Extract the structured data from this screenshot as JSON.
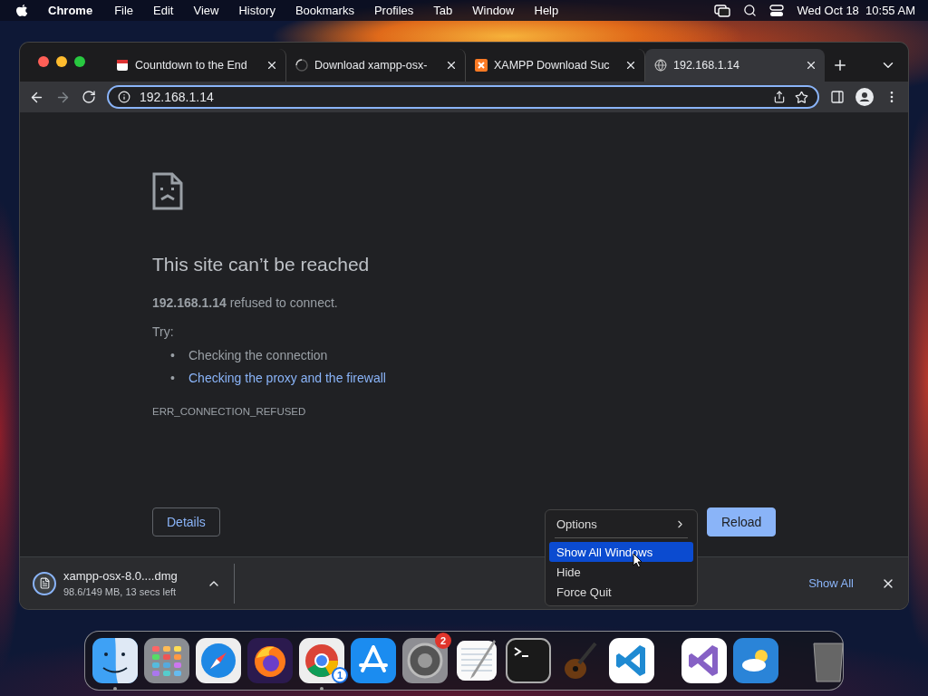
{
  "menu_bar": {
    "app": "Chrome",
    "items": [
      "File",
      "Edit",
      "View",
      "History",
      "Bookmarks",
      "Profiles",
      "Tab",
      "Window",
      "Help"
    ],
    "clock": "Wed Oct 18  10:55 AM"
  },
  "tabs": [
    {
      "title": "Countdown to the End",
      "selected": false
    },
    {
      "title": "Download xampp-osx-",
      "selected": false
    },
    {
      "title": "XAMPP Download Suc",
      "selected": false
    },
    {
      "title": "192.168.1.14",
      "selected": true
    }
  ],
  "address": "192.168.1.14",
  "error": {
    "title": "This site can’t be reached",
    "message": "**192.168.1.14** refused to connect.",
    "try_label": "Try:",
    "suggestions": [
      {
        "bullet": "•",
        "text": "Checking the connection",
        "kind": "text"
      },
      {
        "bullet": "•",
        "text": "Checking the proxy and the firewall",
        "kind": "link"
      }
    ],
    "code": "ERR_CONNECTION_REFUSED",
    "details_button": "Details",
    "reload_button": "Reload"
  },
  "download": {
    "filename": "xampp-osx-8.0....dmg",
    "status": "98.6/149 MB, 13 secs left",
    "show_all": "Show All"
  },
  "context_menu": {
    "items": [
      {
        "label": "Options",
        "submenu": true,
        "selected": false
      },
      {
        "label": "Show All Windows",
        "submenu": false,
        "selected": true
      },
      {
        "label": "Hide",
        "submenu": false,
        "selected": false
      },
      {
        "label": "Force Quit",
        "submenu": false,
        "selected": false
      }
    ]
  },
  "dock": {
    "items": [
      {
        "kind": "finder",
        "running": true
      },
      {
        "kind": "launchpad",
        "running": false
      },
      {
        "kind": "safari",
        "running": false
      },
      {
        "kind": "firefox",
        "running": false
      },
      {
        "kind": "chrome",
        "running": true,
        "badge": "1"
      },
      {
        "kind": "appstore",
        "running": false
      },
      {
        "kind": "settings",
        "running": false,
        "badge": "2"
      },
      {
        "kind": "textedit",
        "running": false
      },
      {
        "kind": "terminal",
        "running": false
      },
      {
        "kind": "guitar",
        "running": false
      },
      {
        "kind": "vscode",
        "running": false
      },
      {
        "kind": "separator"
      },
      {
        "kind": "visualstudio",
        "running": false
      },
      {
        "kind": "weather",
        "running": false
      },
      {
        "kind": "separator"
      },
      {
        "kind": "trash",
        "running": false
      }
    ]
  }
}
